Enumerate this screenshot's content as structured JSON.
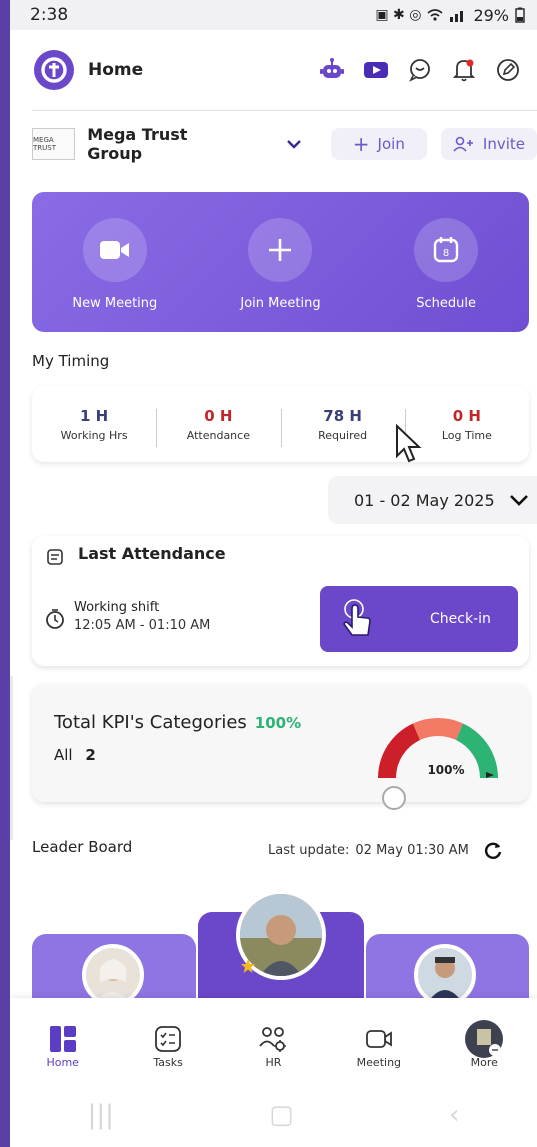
{
  "status_bar": {
    "time": "2:38",
    "battery": "29%"
  },
  "header": {
    "title": "Home"
  },
  "org": {
    "name": "Mega Trust Group",
    "logo_text": "MEGA TRUST",
    "join_label": "Join",
    "invite_label": "Invite"
  },
  "quick_actions": [
    {
      "label": "New Meeting",
      "icon": "video-icon"
    },
    {
      "label": "Join Meeting",
      "icon": "plus-icon"
    },
    {
      "label": "Schedule",
      "icon": "calendar-icon"
    }
  ],
  "my_timing": {
    "title": "My Timing",
    "cells": [
      {
        "value": "1 H",
        "label": "Working Hrs",
        "color": "#3a3f7a"
      },
      {
        "value": "0 H",
        "label": "Attendance",
        "color": "#c0272d"
      },
      {
        "value": "78 H",
        "label": "Required",
        "color": "#3a3f7a"
      },
      {
        "value": "0 H",
        "label": "Log Time",
        "color": "#c0272d"
      }
    ],
    "date_range": "01 - 02 May 2025"
  },
  "attendance": {
    "title": "Last Attendance",
    "shift_label": "Working shift",
    "shift_time": "12:05 AM - 01:10 AM",
    "checkin_label": "Check-in"
  },
  "kpi": {
    "title": "Total KPI's Categories",
    "percent": "100%",
    "all_label": "All",
    "all_count": "2",
    "gauge_label": "100%",
    "gauge_colors": [
      "#cc1f2a",
      "#f27a64",
      "#2db374"
    ]
  },
  "leader_board": {
    "title": "Leader Board",
    "last_update_label": "Last update:",
    "last_update_value": "02 May 01:30 AM"
  },
  "bottom_nav": [
    {
      "label": "Home",
      "icon": "home-grid-icon",
      "active": true
    },
    {
      "label": "Tasks",
      "icon": "tasks-icon",
      "active": false
    },
    {
      "label": "HR",
      "icon": "hr-users-icon",
      "active": false
    },
    {
      "label": "Meeting",
      "icon": "meeting-camera-icon",
      "active": false
    },
    {
      "label": "More",
      "icon": "profile-avatar-icon",
      "active": false
    }
  ],
  "colors": {
    "primary": "#6b47c9",
    "accent_green": "#2db374",
    "alert_red": "#c0272d"
  }
}
